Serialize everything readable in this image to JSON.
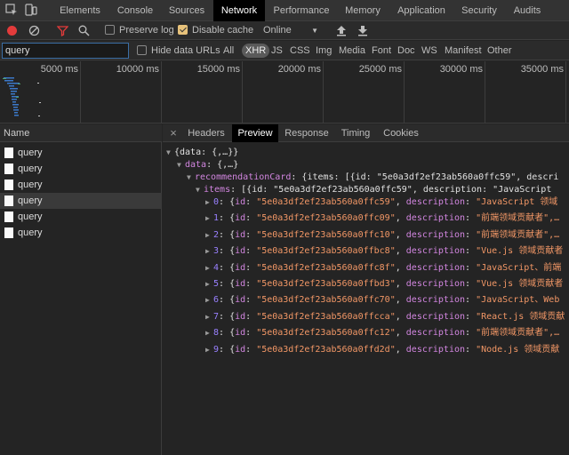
{
  "tabs": [
    "Elements",
    "Console",
    "Sources",
    "Network",
    "Performance",
    "Memory",
    "Application",
    "Security",
    "Audits"
  ],
  "toolbar": {
    "preserve_log": "Preserve log",
    "disable_cache": "Disable cache",
    "throttle": "Online",
    "throttle_arrow": "▼"
  },
  "filter": {
    "value": "query",
    "hide_data_urls": "Hide data URLs",
    "types": [
      "All",
      "XHR",
      "JS",
      "CSS",
      "Img",
      "Media",
      "Font",
      "Doc",
      "WS",
      "Manifest",
      "Other"
    ]
  },
  "timeline": {
    "ticks": [
      "5000 ms",
      "10000 ms",
      "15000 ms",
      "20000 ms",
      "25000 ms",
      "30000 ms",
      "35000 ms"
    ]
  },
  "requests": {
    "header": "Name",
    "items": [
      "query",
      "query",
      "query",
      "query",
      "query",
      "query"
    ]
  },
  "details": {
    "close": "×",
    "tabs": [
      "Headers",
      "Preview",
      "Response",
      "Timing",
      "Cookies"
    ]
  },
  "preview": {
    "root": "{data: {,…}}",
    "data_key": "data",
    "data_val": "{,…}",
    "card_key": "recommendationCard",
    "card_val": "{items: [{id: \"5e0a3df2ef23ab560a0ffc59\", descri",
    "items_key": "items",
    "items_val": "[{id: \"5e0a3df2ef23ab560a0ffc59\", description: \"JavaScript ",
    "items": [
      {
        "index": "0",
        "id": "\"5e0a3df2ef23ab560a0ffc59\"",
        "desc": "\"JavaScript 领域"
      },
      {
        "index": "1",
        "id": "\"5e0a3df2ef23ab560a0ffc09\"",
        "desc": "\"前端领域贡献者\",…"
      },
      {
        "index": "2",
        "id": "\"5e0a3df2ef23ab560a0ffc10\"",
        "desc": "\"前端领域贡献者\",…"
      },
      {
        "index": "3",
        "id": "\"5e0a3df2ef23ab560a0ffbc8\"",
        "desc": "\"Vue.js 领域贡献者"
      },
      {
        "index": "4",
        "id": "\"5e0a3df2ef23ab560a0ffc8f\"",
        "desc": "\"JavaScript、前端"
      },
      {
        "index": "5",
        "id": "\"5e0a3df2ef23ab560a0ffbd3\"",
        "desc": "\"Vue.js 领域贡献者"
      },
      {
        "index": "6",
        "id": "\"5e0a3df2ef23ab560a0ffc70\"",
        "desc": "\"JavaScript、Web"
      },
      {
        "index": "7",
        "id": "\"5e0a3df2ef23ab560a0ffcca\"",
        "desc": "\"React.js 领域贡献"
      },
      {
        "index": "8",
        "id": "\"5e0a3df2ef23ab560a0ffc12\"",
        "desc": "\"前端领域贡献者\",…"
      },
      {
        "index": "9",
        "id": "\"5e0a3df2ef23ab560a0ffd2d\"",
        "desc": "\"Node.js 领域贡献"
      }
    ],
    "id_key": "id",
    "desc_key": "description"
  },
  "colors": {
    "record": "#e33b3b",
    "accent_check": "#e7c27b",
    "json_key": "#d286e0",
    "json_string": "#f29766",
    "json_index": "#9980ff"
  }
}
